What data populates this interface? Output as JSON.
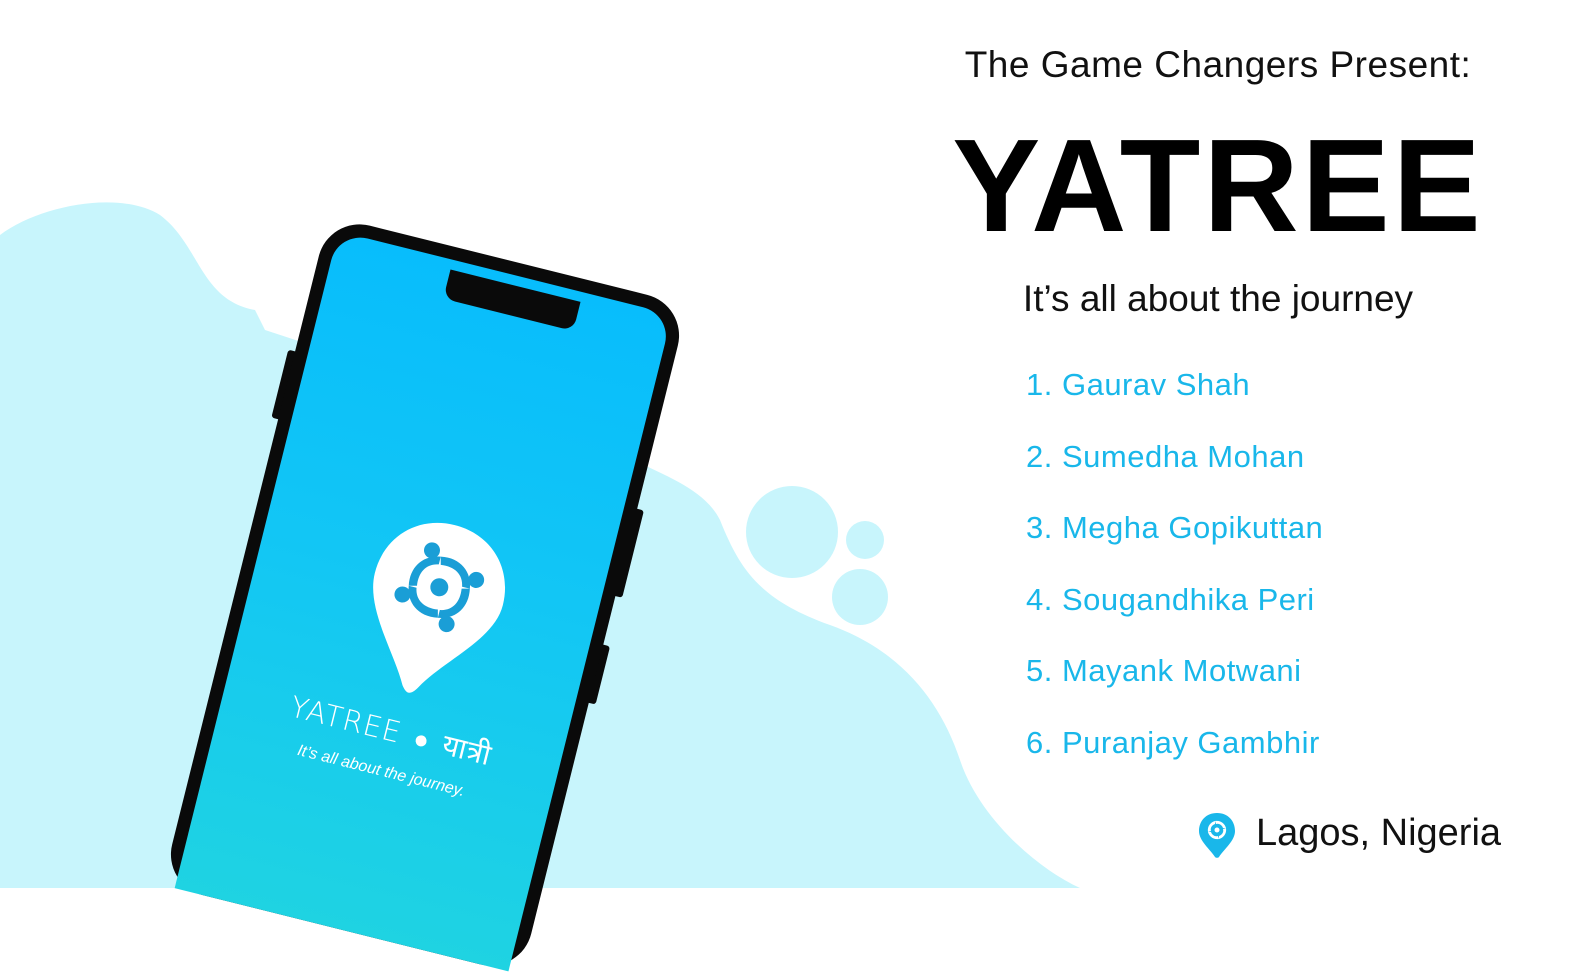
{
  "header": {
    "presenter": "The Game Changers Present:",
    "title": "YATREE",
    "tagline": "It’s all about the journey"
  },
  "team": {
    "members": [
      "1. Gaurav Shah",
      "2. Sumedha Mohan",
      "3. Megha Gopikuttan",
      "4. Sougandhika Peri",
      "5. Mayank Motwani",
      "6. Puranjay Gambhir"
    ]
  },
  "phone": {
    "app_name": "YATREE",
    "app_name_hindi": "यात्री",
    "app_tagline": "It’s all about the journey."
  },
  "location": {
    "icon": "location-pin-icon",
    "text": "Lagos, Nigeria"
  },
  "colors": {
    "accent": "#19b7ea",
    "blob": "#c8f5fc",
    "screen_top": "#08bdfc",
    "screen_bottom": "#1fd3e2"
  }
}
